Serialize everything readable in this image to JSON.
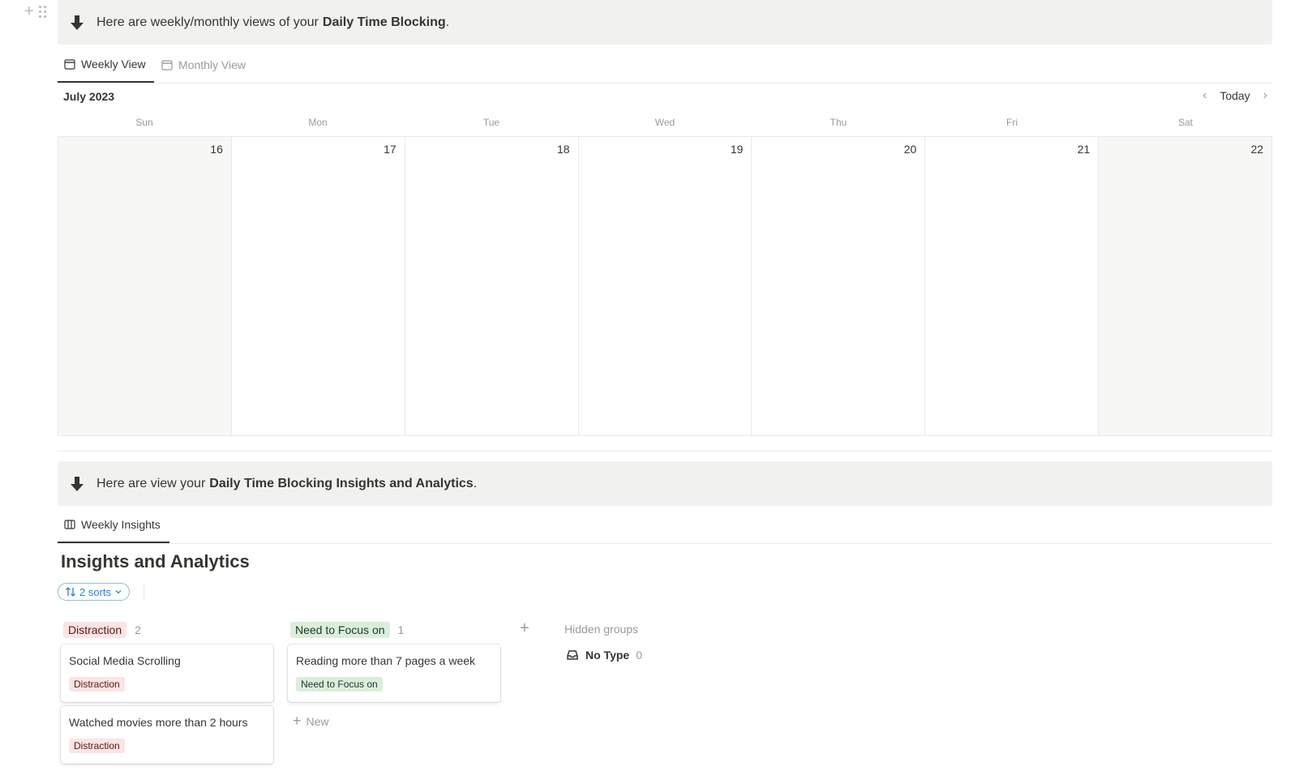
{
  "callout_top": {
    "lead": "Here are weekly/monthly views of your",
    "strong": "Daily Time Blocking",
    "tail": "."
  },
  "calendar_tabs": [
    {
      "label": "Weekly View",
      "active": true
    },
    {
      "label": "Monthly View",
      "active": false
    }
  ],
  "calendar": {
    "month": "July 2023",
    "today_label": "Today",
    "weekdays": [
      "Sun",
      "Mon",
      "Tue",
      "Wed",
      "Thu",
      "Fri",
      "Sat"
    ],
    "days": [
      "16",
      "17",
      "18",
      "19",
      "20",
      "21",
      "22"
    ]
  },
  "callout_bottom": {
    "lead": "Here are view your",
    "strong": "Daily Time Blocking Insights and Analytics",
    "tail": "."
  },
  "insights_tabs": [
    {
      "label": "Weekly Insights",
      "active": true
    }
  ],
  "board": {
    "title": "Insights and Analytics",
    "sort_label": "2 sorts",
    "columns": [
      {
        "tag": "Distraction",
        "count": "2",
        "cards": [
          {
            "title": "Social Media Scrolling",
            "chip": "Distraction"
          },
          {
            "title": "Watched movies more than 2 hours",
            "chip": "Distraction"
          }
        ]
      },
      {
        "tag": "Need to Focus on",
        "count": "1",
        "cards": [
          {
            "title": "Reading more than 7 pages a week",
            "chip": "Need to Focus on"
          }
        ],
        "new_label": "New"
      }
    ],
    "hidden_groups_label": "Hidden groups",
    "hidden_groups": [
      {
        "label": "No Type",
        "count": "0"
      }
    ]
  },
  "colors": {
    "distraction_bg": "#fbe4e4",
    "focus_bg": "#dbeddb",
    "callout_bg": "#f1f1ef",
    "accent_blue": "#2383e2"
  }
}
